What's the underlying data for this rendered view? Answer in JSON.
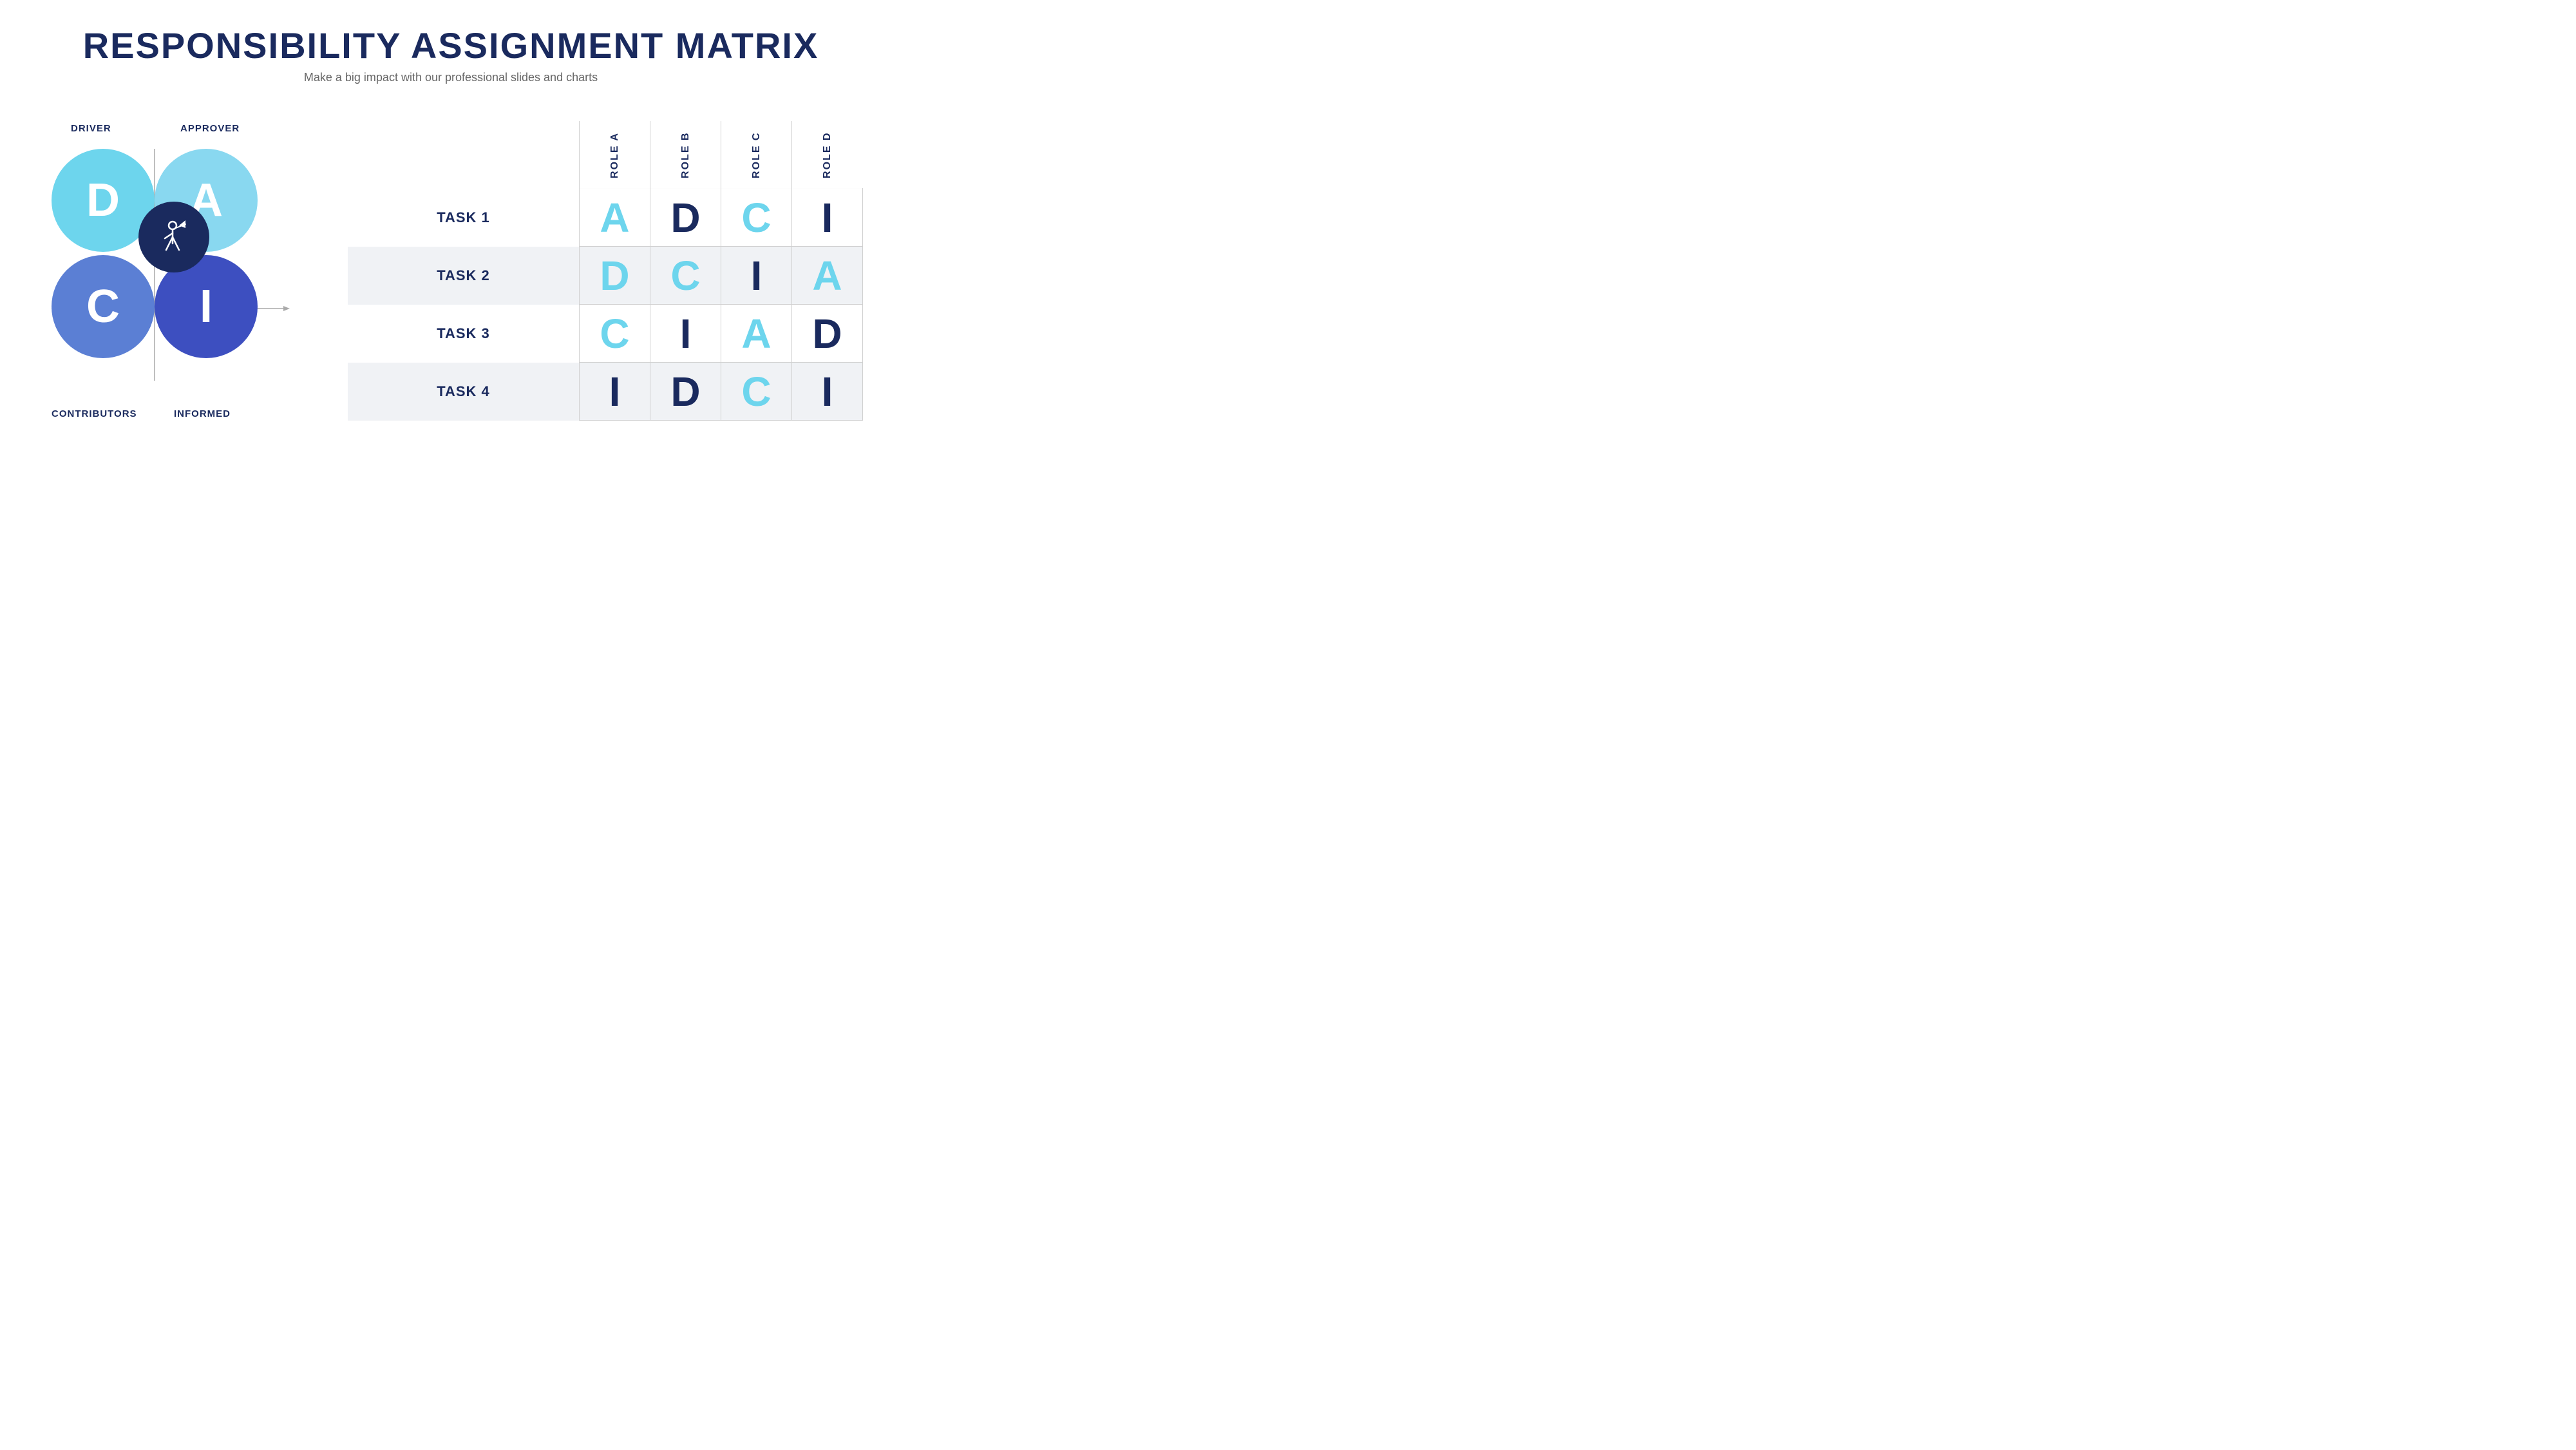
{
  "header": {
    "title": "RESPONSIBILITY ASSIGNMENT MATRIX",
    "subtitle": "Make a big impact with our professional slides and charts"
  },
  "diagram": {
    "labels": {
      "driver": "DRIVER",
      "approver": "APPROVER",
      "contributors": "CONTRIBUTORS",
      "informed": "INFORMED"
    },
    "circles": {
      "d": "D",
      "a": "A",
      "c": "C",
      "i": "I"
    }
  },
  "matrix": {
    "roles": [
      "ROLE A",
      "ROLE B",
      "ROLE C",
      "ROLE D"
    ],
    "rows": [
      {
        "task": "TASK 1",
        "values": [
          "A",
          "D",
          "C",
          "I"
        ],
        "colors": [
          "cyan",
          "dark-blue",
          "cyan",
          "dark-blue"
        ],
        "shade": "white"
      },
      {
        "task": "TASK 2",
        "values": [
          "D",
          "C",
          "I",
          "A"
        ],
        "colors": [
          "cyan",
          "cyan",
          "dark-blue",
          "cyan"
        ],
        "shade": "gray"
      },
      {
        "task": "TASK 3",
        "values": [
          "C",
          "I",
          "A",
          "D"
        ],
        "colors": [
          "cyan",
          "dark-blue",
          "cyan",
          "dark-blue"
        ],
        "shade": "white"
      },
      {
        "task": "TASK 4",
        "values": [
          "I",
          "D",
          "C",
          "I"
        ],
        "colors": [
          "dark-blue",
          "dark-blue",
          "cyan",
          "dark-blue"
        ],
        "shade": "gray"
      }
    ]
  }
}
